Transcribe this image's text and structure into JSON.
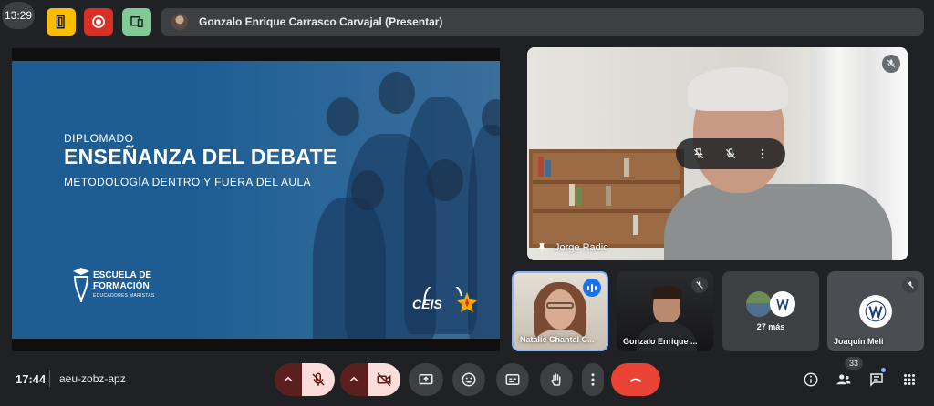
{
  "status": {
    "clock": "13:29"
  },
  "top_bar": {
    "apps": [
      {
        "icon": "door-icon",
        "color": "#fbbc04"
      },
      {
        "icon": "record-icon",
        "color": "#d93025"
      },
      {
        "icon": "devices-icon",
        "color": "#81c995"
      }
    ],
    "presenter": "Gonzalo Enrique Carrasco Carvajal (Presentar)"
  },
  "slide": {
    "eyebrow": "DIPLOMADO",
    "title": "ENSEÑANZA DEL DEBATE",
    "subtitle": "METODOLOGÍA DENTRO Y FUERA DEL AULA",
    "logo_line1": "ESCUELA DE",
    "logo_line2": "FORMACIÓN",
    "logo_line3": "EDUCADORES MARISTAS",
    "partner_logo": "CEIS"
  },
  "main_tile": {
    "name": "Jorge Radic",
    "icons": [
      "pin-off-icon",
      "mic-off-icon",
      "more-vert-icon"
    ]
  },
  "participants": [
    {
      "name": "Natalie Chantal C...",
      "state": "speaking"
    },
    {
      "name": "Gonzalo Enrique ...",
      "state": "muted"
    },
    {
      "name": "27 más",
      "state": "overflow"
    },
    {
      "name": "Joaquín Meli",
      "state": "muted"
    }
  ],
  "bottom_bar": {
    "time": "17:44",
    "meeting_code": "aeu-zobz-apz",
    "controls": [
      "mic-off-icon",
      "camera-off-icon",
      "present-icon",
      "emoji-icon",
      "captions-icon",
      "hand-icon",
      "more-vert-icon",
      "end-call-icon"
    ],
    "people_count": "33",
    "right_icons": [
      "info-icon",
      "people-icon",
      "chat-icon",
      "activities-icon"
    ],
    "colors": {
      "danger_dark": "#5c1f1f",
      "danger_light": "#f9dedc",
      "end_call": "#ea4335",
      "accent": "#8ab4f8"
    }
  }
}
